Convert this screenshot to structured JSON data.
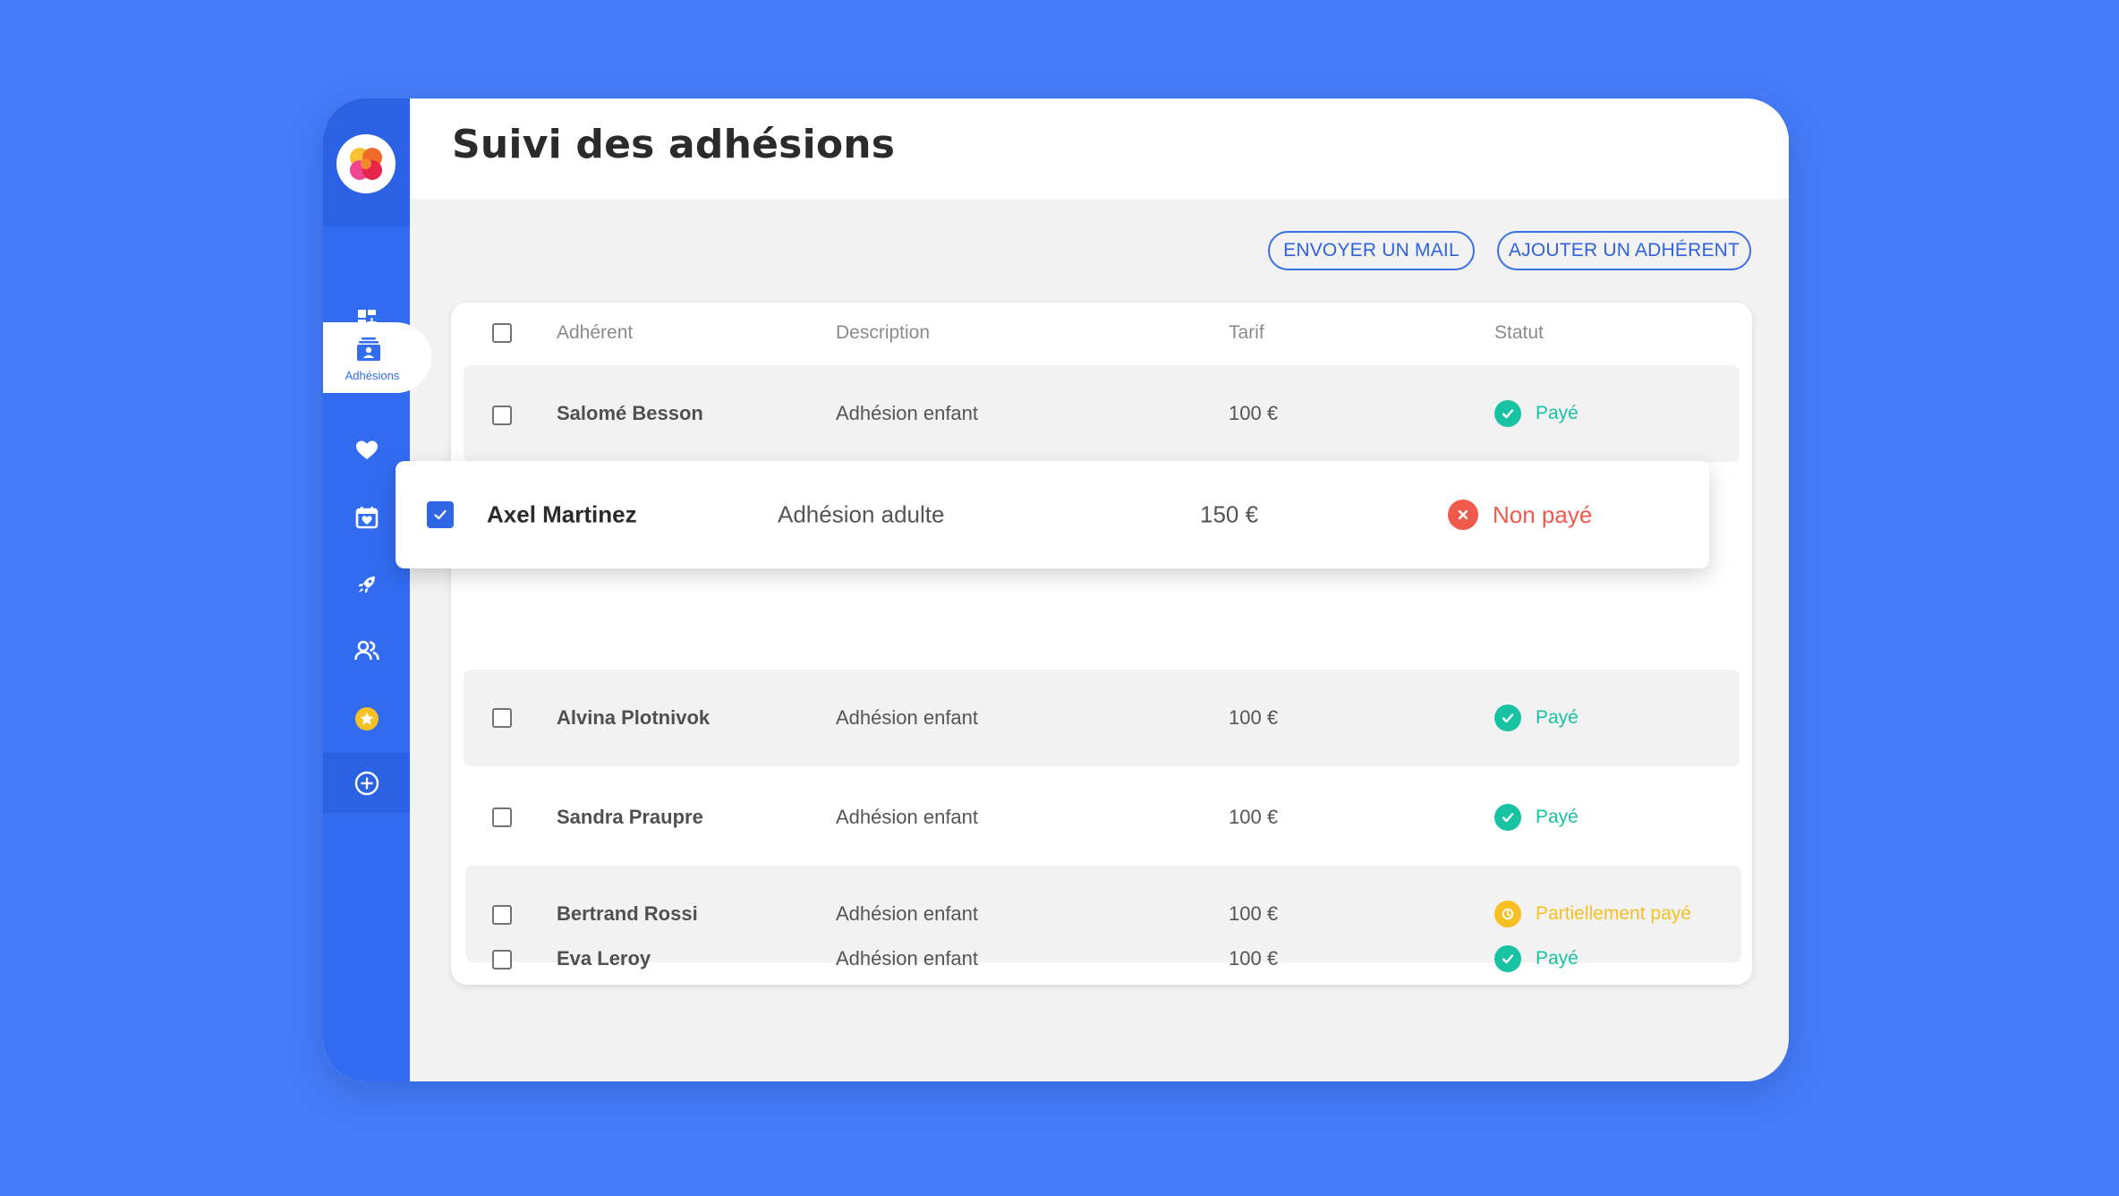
{
  "app": {
    "title": "Suivi des adhésions"
  },
  "sidebar": {
    "items": [
      {
        "name": "dashboard",
        "icon": "dashboard-grid-icon",
        "active": false
      },
      {
        "name": "adhesions",
        "icon": "membership-card-icon",
        "active": true,
        "label": "Adhésions"
      },
      {
        "name": "dons",
        "icon": "heart-icon",
        "active": false
      },
      {
        "name": "evenements",
        "icon": "calendar-heart-icon",
        "active": false
      },
      {
        "name": "campagnes",
        "icon": "rocket-icon",
        "active": false
      },
      {
        "name": "contacts",
        "icon": "users-icon",
        "active": false
      },
      {
        "name": "premium",
        "icon": "star-badge-icon",
        "active": false
      }
    ],
    "add_icon": "plus-circle-icon"
  },
  "toolbar": {
    "send_mail_label": "ENVOYER UN MAIL",
    "add_member_label": "AJOUTER UN ADHÉRENT"
  },
  "table": {
    "headers": {
      "member": "Adhérent",
      "description": "Description",
      "price": "Tarif",
      "status": "Statut"
    },
    "rows": [
      {
        "member": "Salomé Besson",
        "description": "Adhésion enfant",
        "price": "100 €",
        "status": "Payé",
        "status_type": "paid"
      },
      {
        "member": "Axel Martinez",
        "description": "Adhésion adulte",
        "price": "150 €",
        "status": "Non payé",
        "status_type": "unpaid",
        "selected": true
      },
      {
        "member": "Alvina Plotnivok",
        "description": "Adhésion enfant",
        "price": "100 €",
        "status": "Payé",
        "status_type": "paid"
      },
      {
        "member": "Sandra Praupre",
        "description": "Adhésion enfant",
        "price": "100 €",
        "status": "Payé",
        "status_type": "paid"
      },
      {
        "member": "Bertrand Rossi",
        "description": "Adhésion enfant",
        "price": "100 €",
        "status": "Partiellement payé",
        "status_type": "partial"
      },
      {
        "member": "Eva Leroy",
        "description": "Adhésion enfant",
        "price": "100 €",
        "status": "Payé",
        "status_type": "paid"
      }
    ]
  },
  "colors": {
    "background": "#457cf9",
    "sidebar": "#316bf0",
    "accent": "#2f66e6",
    "paid": "#17c3a2",
    "unpaid": "#ef5a4c",
    "partial": "#f6c024"
  }
}
